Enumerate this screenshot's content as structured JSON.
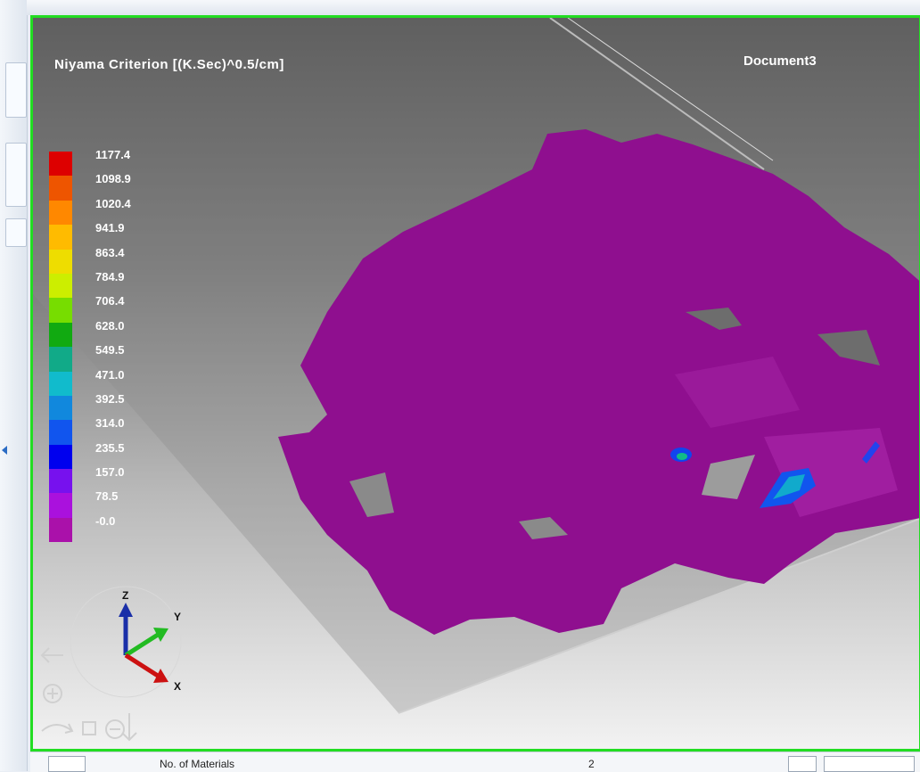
{
  "viewport": {
    "title": "Niyama Criterion  [(K.Sec)^0.5/cm]",
    "document_name": "Document3",
    "legend": [
      {
        "label": "1177.4",
        "color": "#dd0000"
      },
      {
        "label": "1098.9",
        "color": "#ee5500"
      },
      {
        "label": "1020.4",
        "color": "#ff8800"
      },
      {
        "label": "941.9",
        "color": "#ffbb00"
      },
      {
        "label": "863.4",
        "color": "#eedd00"
      },
      {
        "label": "784.9",
        "color": "#ccee00"
      },
      {
        "label": "706.4",
        "color": "#77dd00"
      },
      {
        "label": "628.0",
        "color": "#11aa11"
      },
      {
        "label": "549.5",
        "color": "#11aa88"
      },
      {
        "label": "471.0",
        "color": "#11bbcc"
      },
      {
        "label": "392.5",
        "color": "#1188dd"
      },
      {
        "label": "314.0",
        "color": "#1155ee"
      },
      {
        "label": "235.5",
        "color": "#0000ee"
      },
      {
        "label": "157.0",
        "color": "#7711ee"
      },
      {
        "label": "78.5",
        "color": "#aa11dd"
      },
      {
        "label": "-0.0",
        "color": "#aa11aa"
      }
    ],
    "axes": {
      "z": "Z",
      "y": "Y",
      "x": "X"
    },
    "part_color": "#8f0f8f"
  },
  "statusbar": {
    "label": "No. of Materials",
    "value": "2"
  }
}
